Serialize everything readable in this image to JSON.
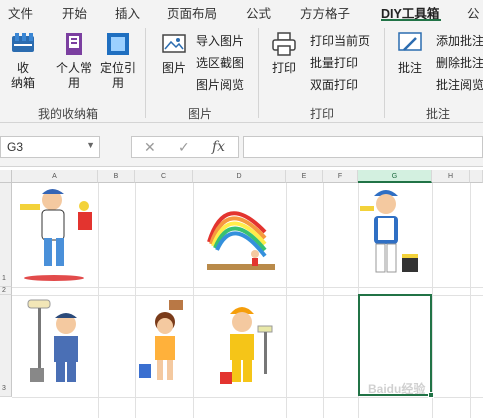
{
  "tabs": [
    "文件",
    "开始",
    "插入",
    "页面布局",
    "公式",
    "方方格子",
    "DIY工具箱",
    "公"
  ],
  "active_tab": "DIY工具箱",
  "ribbon": {
    "collect_label": "收\n纳箱",
    "personal_label": "个人常\n用",
    "locate_label": "定位引\n用",
    "group_mybox": "我的收纳箱",
    "picture_label": "图片",
    "import_picture": "导入图片",
    "select_screenshot": "选区截图",
    "picture_browse": "图片阅览",
    "group_picture": "图片",
    "print_label": "打印",
    "print_current": "打印当前页",
    "batch_print": "批量打印",
    "duplex_print": "双面打印",
    "group_print": "打印",
    "comment_label": "批注",
    "add_comment": "添加批注",
    "delete_comment": "删除批注",
    "comment_browse": "批注阅览",
    "group_comment": "批注"
  },
  "formula_bar": {
    "name_box": "G3",
    "cancel_icon": "✕",
    "confirm_icon": "✓",
    "fx_icon": "fx",
    "formula": ""
  },
  "grid": {
    "columns": [
      "A",
      "B",
      "C",
      "D",
      "E",
      "F",
      "G",
      "H"
    ],
    "rows": [
      "1",
      "2",
      "3"
    ],
    "selected_column": "G"
  },
  "watermark": "Baidu经验",
  "colors": {
    "accent": "#217346"
  }
}
